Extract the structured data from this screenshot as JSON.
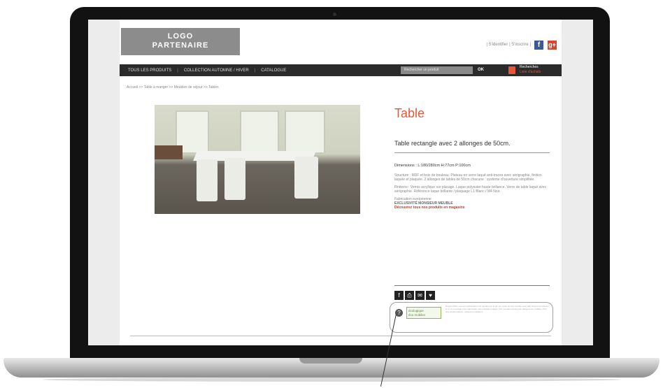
{
  "header": {
    "logo_line1": "LOGO",
    "logo_line2": "PARTENAIRE",
    "top_links": "| S'identifier | S'inscrire |",
    "social_icons": [
      "facebook-icon",
      "google-plus-icon"
    ]
  },
  "nav": {
    "items": [
      "TOUS LES PRODUITS",
      "COLLECTION AUTOMNE / HIVER",
      "CATALOGUE"
    ],
    "separator": "|",
    "search_placeholder": "Rechercher un produit",
    "search_button": "OK",
    "cart_title": "Recherches",
    "cart_subtitle": "Liste d'achats"
  },
  "breadcrumb": "Accueil >> Table à manger >> Meubles de séjour >> Tables",
  "product": {
    "title": "Table",
    "subtitle": "Table rectangle avec 2 allonges de 50cm.",
    "dimensions": "Dimensions : L:180/280cm H:77cm P:100cm",
    "description_1": "Structure : MDF et bois de bouleau. Plateau en verre laqué anti-traces avec sérigraphie, finition laquée et plaquée. 2 allonges de tables de 50cm chacune : système d'ouverture simplifiée.",
    "description_2": "Finitions : Vernis acrylique sur placage. Laque polyester haute brillance. Verre de table laqué avec sérigraphie. Référence laque brillante / plaquage L1 Blanc / M4 Noir.",
    "fabrication": "Fabrication européenne",
    "exclusive": "EXCLUSIVITÉ MONSIEUR MEUBLE",
    "promo": "Découvrez tous nos produits en magasins"
  },
  "share_icons": [
    "facebook-icon",
    "print-icon",
    "email-icon",
    "heart-icon"
  ],
  "eco": {
    "question": "?",
    "logo_line1": "écologique",
    "logo_line2": "éco mobilier",
    "text": "Depuis 2013, une éco-participation est ajoutée sur le prix de vente de tout meuble neuf. Elle finance la collecte, le tri, le recyclage et la valorisation des meubles usagés. Son montant est fixé par catégorie de mobilier. Pour plus d'informations : www.eco-mobilier.fr"
  },
  "colors": {
    "accent": "#e8563a",
    "nav_bg": "#2b2b2b",
    "logo_bg": "#8c8c8c"
  }
}
